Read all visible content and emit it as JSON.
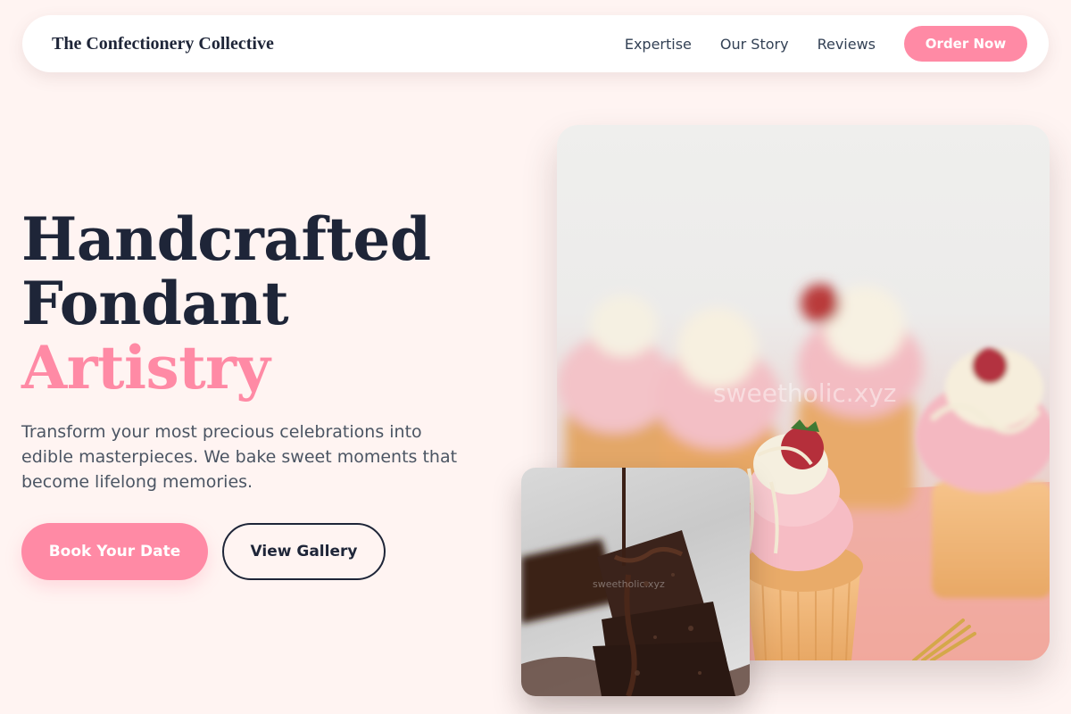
{
  "header": {
    "brand": "The Confectionery Collective",
    "nav": [
      {
        "label": "Expertise"
      },
      {
        "label": "Our Story"
      },
      {
        "label": "Reviews"
      }
    ],
    "cta_label": "Order Now"
  },
  "hero": {
    "headline_line1": "Handcrafted",
    "headline_line2": "Fondant",
    "headline_accent": "Artistry",
    "description": "Transform your most precious celebrations into edible masterpieces. We bake sweet moments that become lifelong memories.",
    "primary_button": "Book Your Date",
    "secondary_button": "View Gallery"
  },
  "images": {
    "main_watermark": "sweetholic.xyz",
    "small_watermark": "sweetholic.xyz"
  },
  "colors": {
    "background": "#fff4f2",
    "accent": "#ff8aa5",
    "navy": "#1e2538"
  }
}
